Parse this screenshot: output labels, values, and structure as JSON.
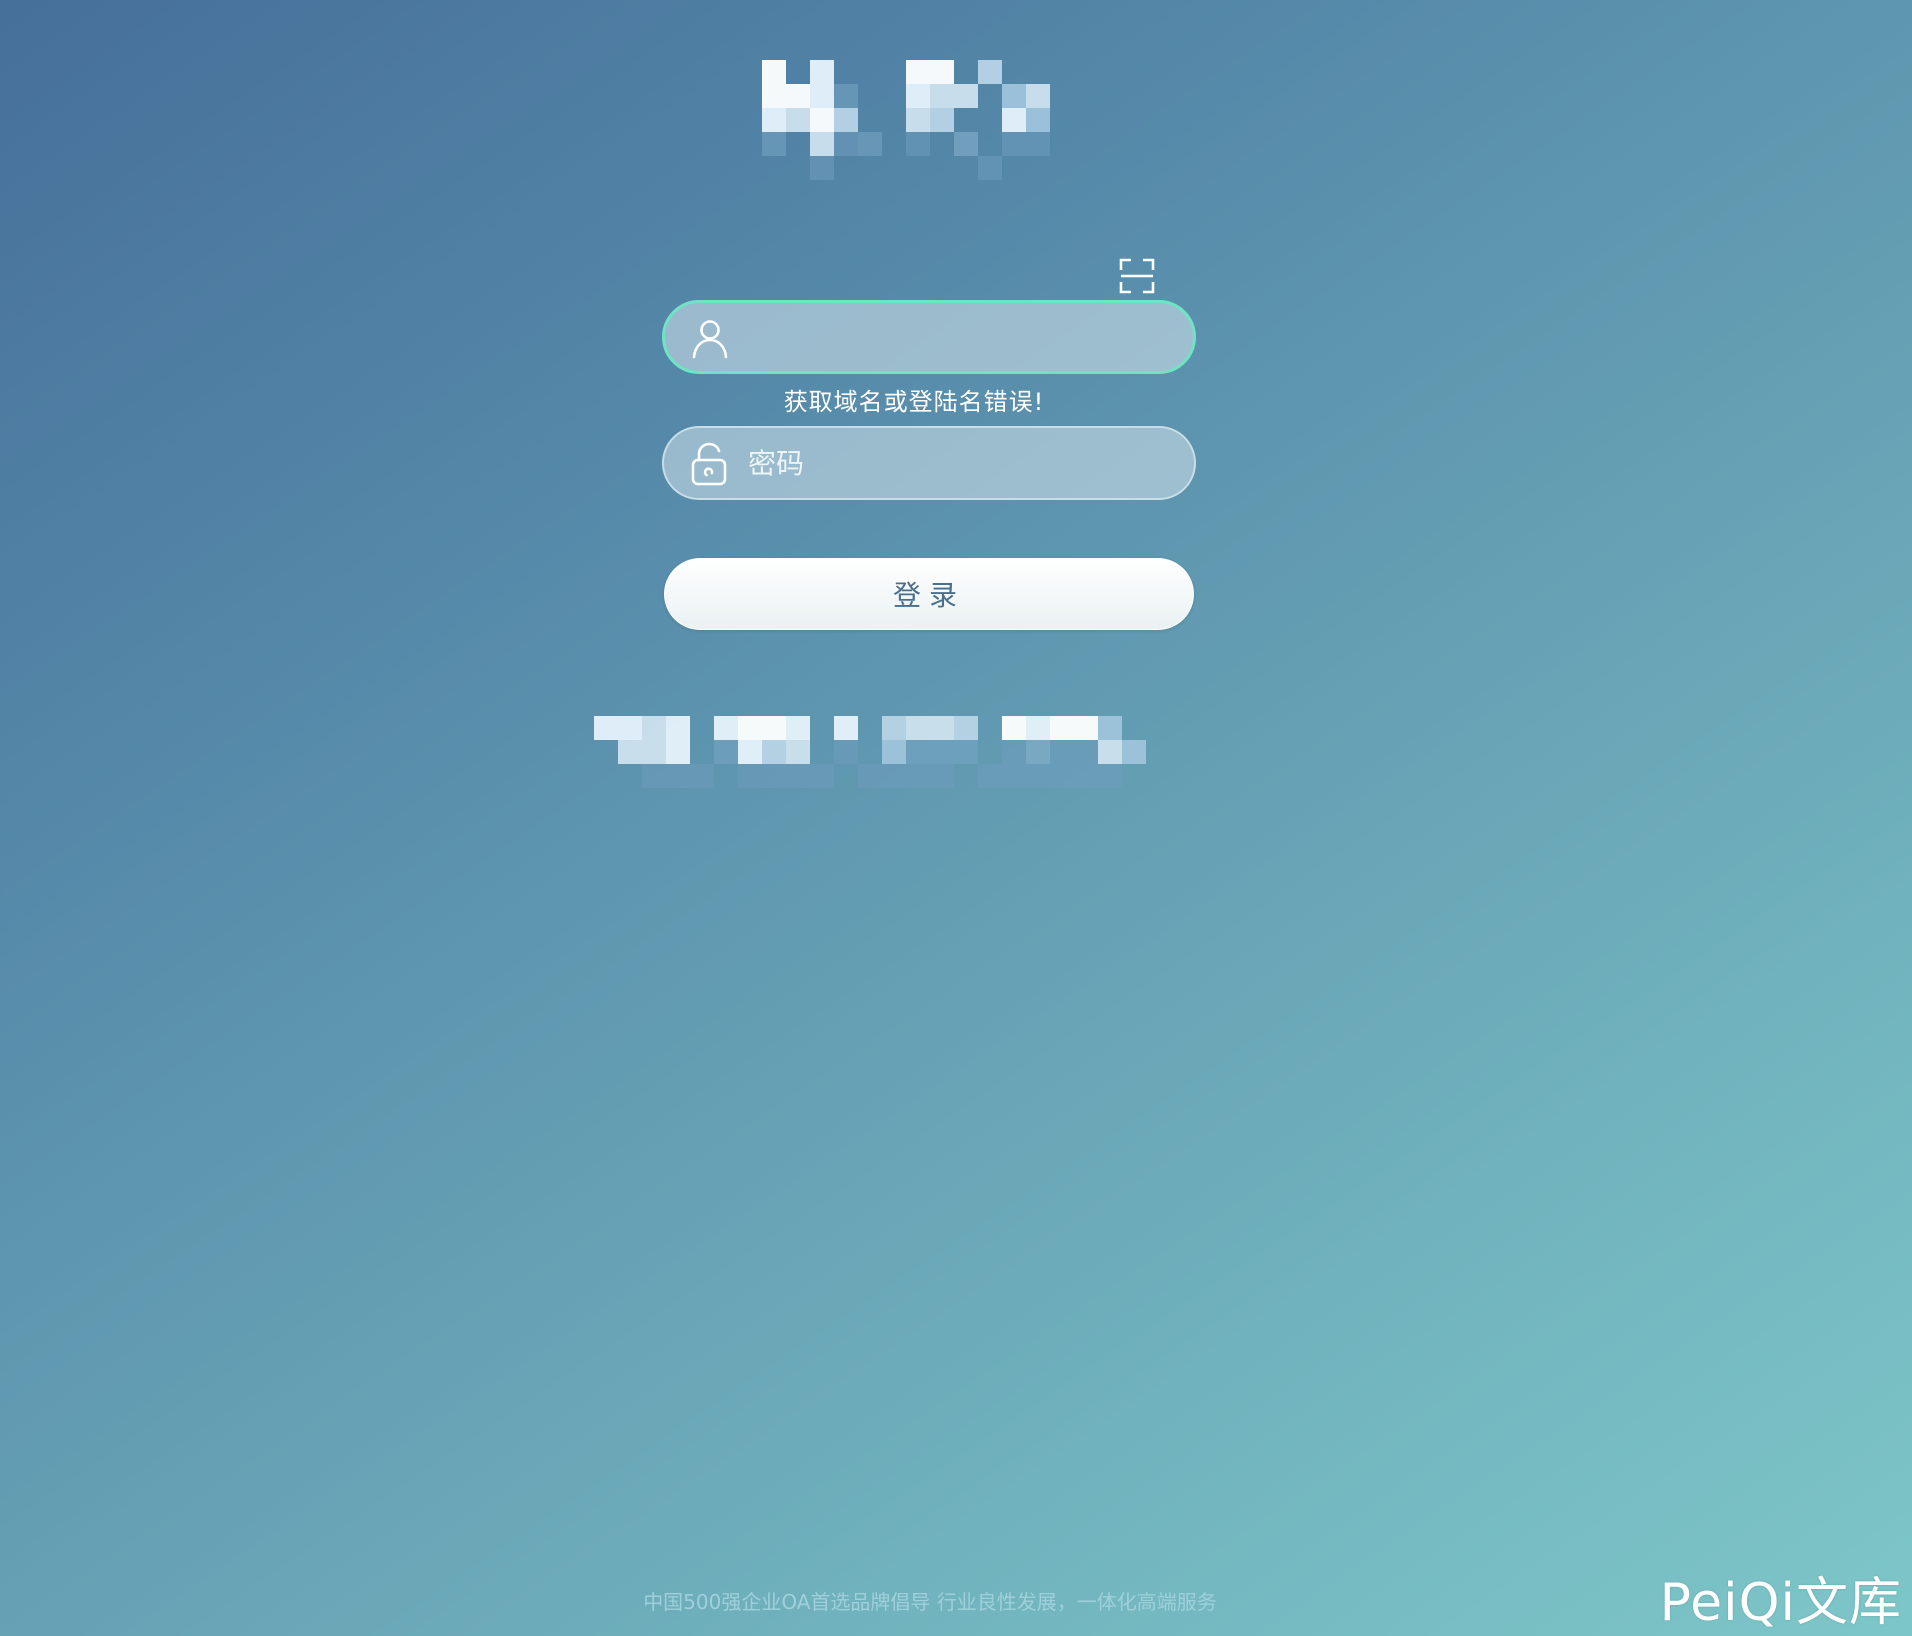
{
  "scan": {
    "icon": "scan-icon"
  },
  "login_form": {
    "username": {
      "icon": "user-icon",
      "value": "",
      "placeholder": ""
    },
    "error_message": "获取域名或登陆名错误!",
    "password": {
      "icon": "unlock-icon",
      "value": "",
      "placeholder": "密码"
    },
    "submit_label": "登录"
  },
  "footer": {
    "slogan": "中国500强企业OA首选品牌倡导 行业良性发展，一体化高端服务"
  },
  "watermark": {
    "text": "PeiQi文库"
  },
  "colors": {
    "background_top_left": "#466f9a",
    "background_bottom_right": "#7dc6c8",
    "focus_border": "#6fe3c4",
    "button_text": "#4b6f8a"
  }
}
